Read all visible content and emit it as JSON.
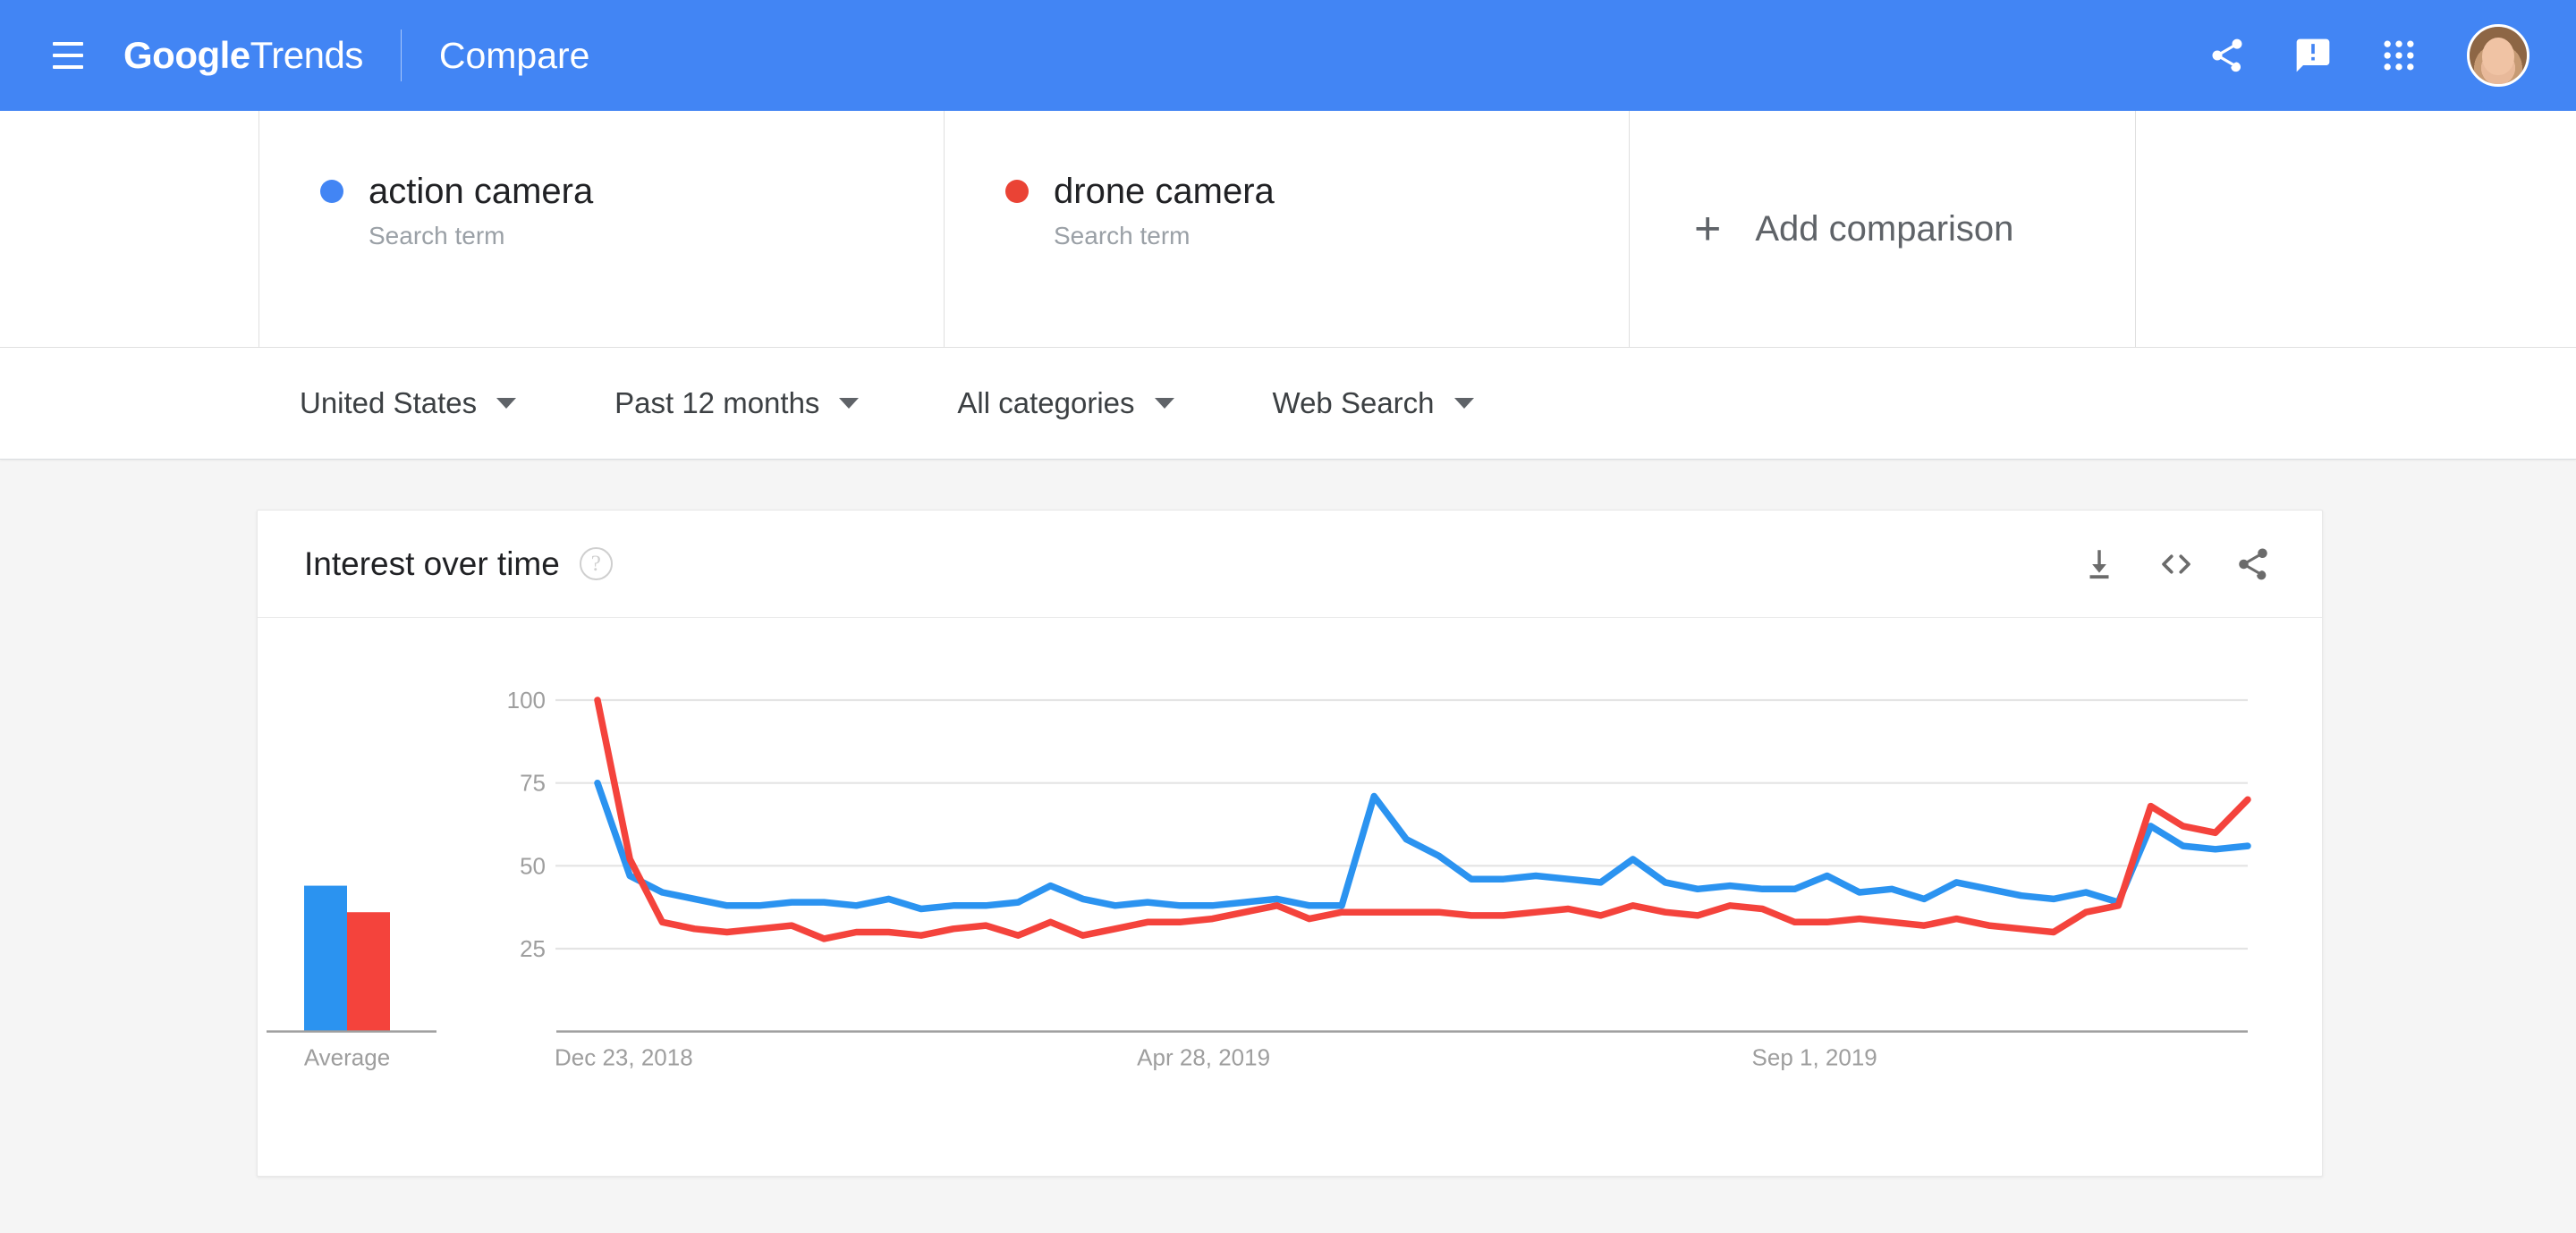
{
  "header": {
    "menu_icon": "hamburger-menu-icon",
    "brand_google": "Google",
    "brand_trends": "Trends",
    "page_label": "Compare",
    "share_icon": "share-icon",
    "feedback_icon": "feedback-icon",
    "apps_icon": "apps-grid-icon",
    "avatar_icon": "user-avatar"
  },
  "terms": [
    {
      "name": "action camera",
      "type": "Search term",
      "color": "#4285f4"
    },
    {
      "name": "drone camera",
      "type": "Search term",
      "color": "#ea4335"
    }
  ],
  "add_comparison": {
    "plus": "+",
    "label": "Add comparison"
  },
  "filters": [
    {
      "label": "United States"
    },
    {
      "label": "Past 12 months"
    },
    {
      "label": "All categories"
    },
    {
      "label": "Web Search"
    }
  ],
  "card": {
    "title": "Interest over time",
    "help": "?",
    "download_icon": "download-icon",
    "embed_icon": "embed-code-icon",
    "share_icon": "share-icon"
  },
  "chart_data": {
    "type": "line",
    "title": "Interest over time",
    "xlabel": "",
    "ylabel": "",
    "ylim": [
      0,
      100
    ],
    "y_ticks": [
      100,
      75,
      50,
      25
    ],
    "x_ticks": [
      "Dec 23, 2018",
      "Apr 28, 2019",
      "Sep 1, 2019"
    ],
    "grid": true,
    "legend_position": "top",
    "series": [
      {
        "name": "action camera",
        "color": "#2b93f0",
        "values": [
          75,
          47,
          42,
          40,
          38,
          38,
          39,
          39,
          38,
          40,
          37,
          38,
          38,
          39,
          44,
          40,
          38,
          39,
          38,
          38,
          39,
          40,
          38,
          38,
          71,
          58,
          53,
          46,
          46,
          47,
          46,
          45,
          52,
          45,
          43,
          44,
          43,
          43,
          47,
          42,
          43,
          40,
          45,
          43,
          41,
          40,
          42,
          39,
          62,
          56,
          55,
          56
        ]
      },
      {
        "name": "drone camera",
        "color": "#f4433c",
        "values": [
          100,
          52,
          33,
          31,
          30,
          31,
          32,
          28,
          30,
          30,
          29,
          31,
          32,
          29,
          33,
          29,
          31,
          33,
          33,
          34,
          36,
          38,
          34,
          36,
          36,
          36,
          36,
          35,
          35,
          36,
          37,
          35,
          38,
          36,
          35,
          38,
          37,
          33,
          33,
          34,
          33,
          32,
          34,
          32,
          31,
          30,
          36,
          38,
          68,
          62,
          60,
          70
        ]
      }
    ],
    "average_bars": {
      "label": "Average",
      "bars": [
        {
          "name": "action camera",
          "value": 44,
          "color": "#2b93f0"
        },
        {
          "name": "drone camera",
          "value": 36,
          "color": "#f4433c"
        }
      ]
    }
  }
}
